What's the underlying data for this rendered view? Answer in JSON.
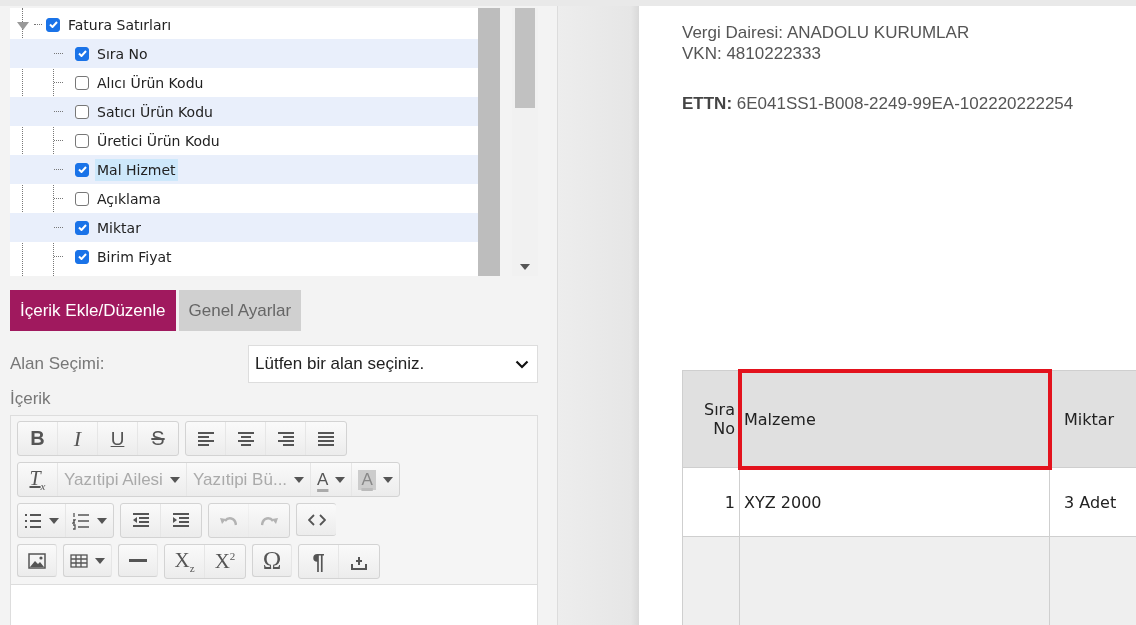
{
  "tree": {
    "root": {
      "label": "Fatura Satırları",
      "checked": true,
      "expanded": true,
      "selected": false,
      "children": [
        {
          "label": "Sıra No",
          "checked": true,
          "selected": false
        },
        {
          "label": "Alıcı Ürün Kodu",
          "checked": false,
          "selected": false
        },
        {
          "label": "Satıcı Ürün Kodu",
          "checked": false,
          "selected": false
        },
        {
          "label": "Üretici Ürün Kodu",
          "checked": false,
          "selected": false
        },
        {
          "label": "Mal Hizmet",
          "checked": true,
          "selected": true
        },
        {
          "label": "Açıklama",
          "checked": false,
          "selected": false
        },
        {
          "label": "Miktar",
          "checked": true,
          "selected": false
        },
        {
          "label": "Birim Fiyat",
          "checked": true,
          "selected": false
        }
      ]
    }
  },
  "tabs": [
    {
      "label": "İçerik Ekle/Düzenle",
      "selected": true
    },
    {
      "label": "Genel Ayarlar",
      "selected": false
    }
  ],
  "field_select": {
    "label": "Alan Seçimi:",
    "value": "Lütfen bir alan seçiniz."
  },
  "content_label": "İçerik",
  "editor": {
    "toolbar": [
      [
        [
          {
            "kind": "bold",
            "text": "B",
            "disabled": false
          },
          {
            "kind": "italic",
            "text": "I",
            "disabled": false
          },
          {
            "kind": "underline",
            "text": "U",
            "disabled": false
          },
          {
            "kind": "strike",
            "text": "S",
            "disabled": false
          }
        ],
        [
          {
            "kind": "align-left",
            "disabled": false
          },
          {
            "kind": "align-center",
            "disabled": false
          },
          {
            "kind": "align-right",
            "disabled": false
          },
          {
            "kind": "justify",
            "disabled": false
          }
        ]
      ],
      [
        [
          {
            "kind": "clear-format",
            "text": "T$_{x}$",
            "disabled": false
          },
          {
            "kind": "font-family",
            "text": "Yazıtipi Ailesi",
            "disabled": false
          },
          {
            "kind": "font-size",
            "text": "Yazıtipi Bü...",
            "disabled": false
          },
          {
            "kind": "text-color",
            "text": "A",
            "disabled": false
          },
          {
            "kind": "bg-color",
            "text": "A",
            "disabled": false
          }
        ]
      ],
      [
        [
          {
            "kind": "bullets",
            "disabled": false
          },
          {
            "kind": "numbers",
            "disabled": false
          }
        ],
        [
          {
            "kind": "outdent",
            "disabled": false
          },
          {
            "kind": "indent",
            "disabled": false
          }
        ],
        [
          {
            "kind": "undo",
            "disabled": true
          },
          {
            "kind": "redo",
            "disabled": true
          }
        ],
        [
          {
            "kind": "source",
            "disabled": false
          }
        ]
      ],
      [
        [
          {
            "kind": "image",
            "disabled": false
          }
        ],
        [
          {
            "kind": "table",
            "disabled": false
          }
        ],
        [
          {
            "kind": "rule",
            "disabled": false
          }
        ],
        [
          {
            "kind": "subscript",
            "text": "X$_{z}$",
            "disabled": false
          },
          {
            "kind": "superscript",
            "text": "X$^{2}$",
            "disabled": false
          }
        ],
        [
          {
            "kind": "symbol",
            "text": "Ω",
            "disabled": false
          }
        ],
        [
          {
            "kind": "paragraph",
            "text": "¶",
            "disabled": false
          },
          {
            "kind": "upload",
            "disabled": false
          }
        ]
      ]
    ]
  },
  "document": {
    "lines": [
      "Vergi Dairesi: ANADOLU KURUMLAR",
      "VKN: 4810222333"
    ],
    "ettn": "**ETTN:** 6E041SS1-B008-2249-99EA-102220222254",
    "table": {
      "columns": [
        {
          "label": "Sıra No",
          "highlighted": false
        },
        {
          "label": "Malzeme",
          "highlighted": true
        },
        {
          "label": "Miktar",
          "highlighted": false
        }
      ],
      "rows": [
        [
          "1",
          "XYZ 2000",
          "3 Adet"
        ]
      ]
    }
  }
}
